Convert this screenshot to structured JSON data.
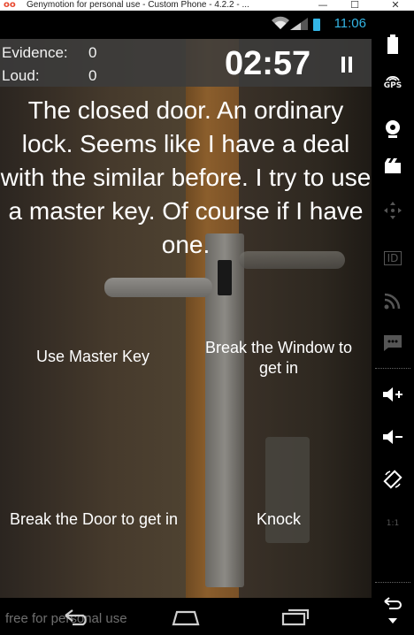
{
  "window": {
    "title": "Genymotion for personal use - Custom Phone - 4.2.2 - ...",
    "logo": "oo",
    "minimize": "—",
    "maximize": "☐",
    "close": "✕"
  },
  "statusbar": {
    "time": "11:06"
  },
  "hud": {
    "evidence_label": "Evidence:",
    "evidence_value": "0",
    "loud_label": "Loud:",
    "loud_value": "0",
    "timer": "02:57"
  },
  "story": {
    "text": "The closed door. An ordinary lock. Seems like I have a deal with the similar before. I try to use a master key. Of course if I have one."
  },
  "choices": [
    {
      "label": "Use Master Key"
    },
    {
      "label": "Break the Window to get in"
    },
    {
      "label": "Break the Door to get in"
    },
    {
      "label": "Knock"
    }
  ],
  "watermark": "free for personal use",
  "sidebar": {
    "tools": [
      "battery-icon",
      "gps-icon",
      "webcam-icon",
      "screencast-icon",
      "dpad-icon",
      "id-icon",
      "network-icon",
      "sms-icon",
      "volume-up-icon",
      "volume-down-icon",
      "rotate-icon",
      "scale-icon",
      "back-icon",
      "menu-icon"
    ],
    "gps_label": "GPS",
    "id_label": "ID",
    "scale_label": "1:1"
  }
}
